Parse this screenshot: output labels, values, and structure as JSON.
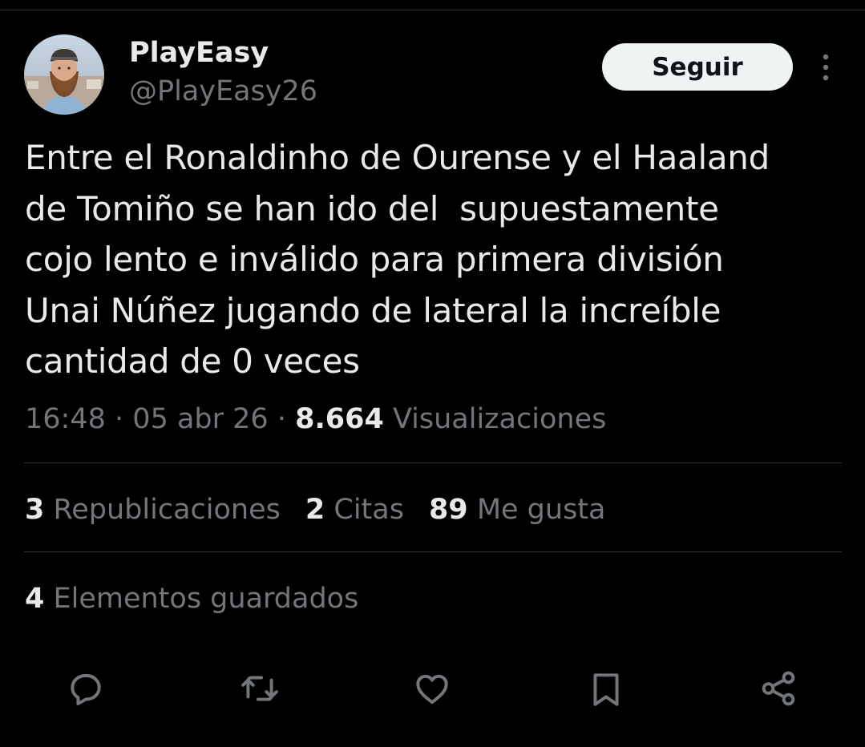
{
  "author": {
    "display_name": "PlayEasy",
    "handle": "@PlayEasy26",
    "avatar_icon": "profile-photo"
  },
  "follow_label": "Seguir",
  "tweet": {
    "lines": [
      "Entre el Ronaldinho de Ourense y el Haaland",
      "de Tomiño se han ido del  supuestamente",
      "cojo lento e inválido para primera división",
      "Unai Núñez jugando de lateral la increíble",
      "cantidad de 0 veces"
    ]
  },
  "meta": {
    "time": "16:48",
    "separator": "·",
    "date": "05 abr 26",
    "views": "8.664",
    "views_label": "Visualizaciones"
  },
  "stats": {
    "reposts": {
      "num": "3",
      "label": "Republicaciones"
    },
    "quotes": {
      "num": "2",
      "label": "Citas"
    },
    "likes": {
      "num": "89",
      "label": "Me gusta"
    },
    "saved": {
      "num": "4",
      "label": "Elementos guardados"
    }
  },
  "actions": [
    {
      "icon": "reply-icon"
    },
    {
      "icon": "repost-icon"
    },
    {
      "icon": "like-icon"
    },
    {
      "icon": "bookmark-icon"
    },
    {
      "icon": "share-icon"
    }
  ],
  "colors": {
    "background": "#000000",
    "text_primary": "#e7e9ea",
    "text_secondary": "#71767b",
    "divider": "#2f3336",
    "button_bg": "#eff3f4"
  }
}
